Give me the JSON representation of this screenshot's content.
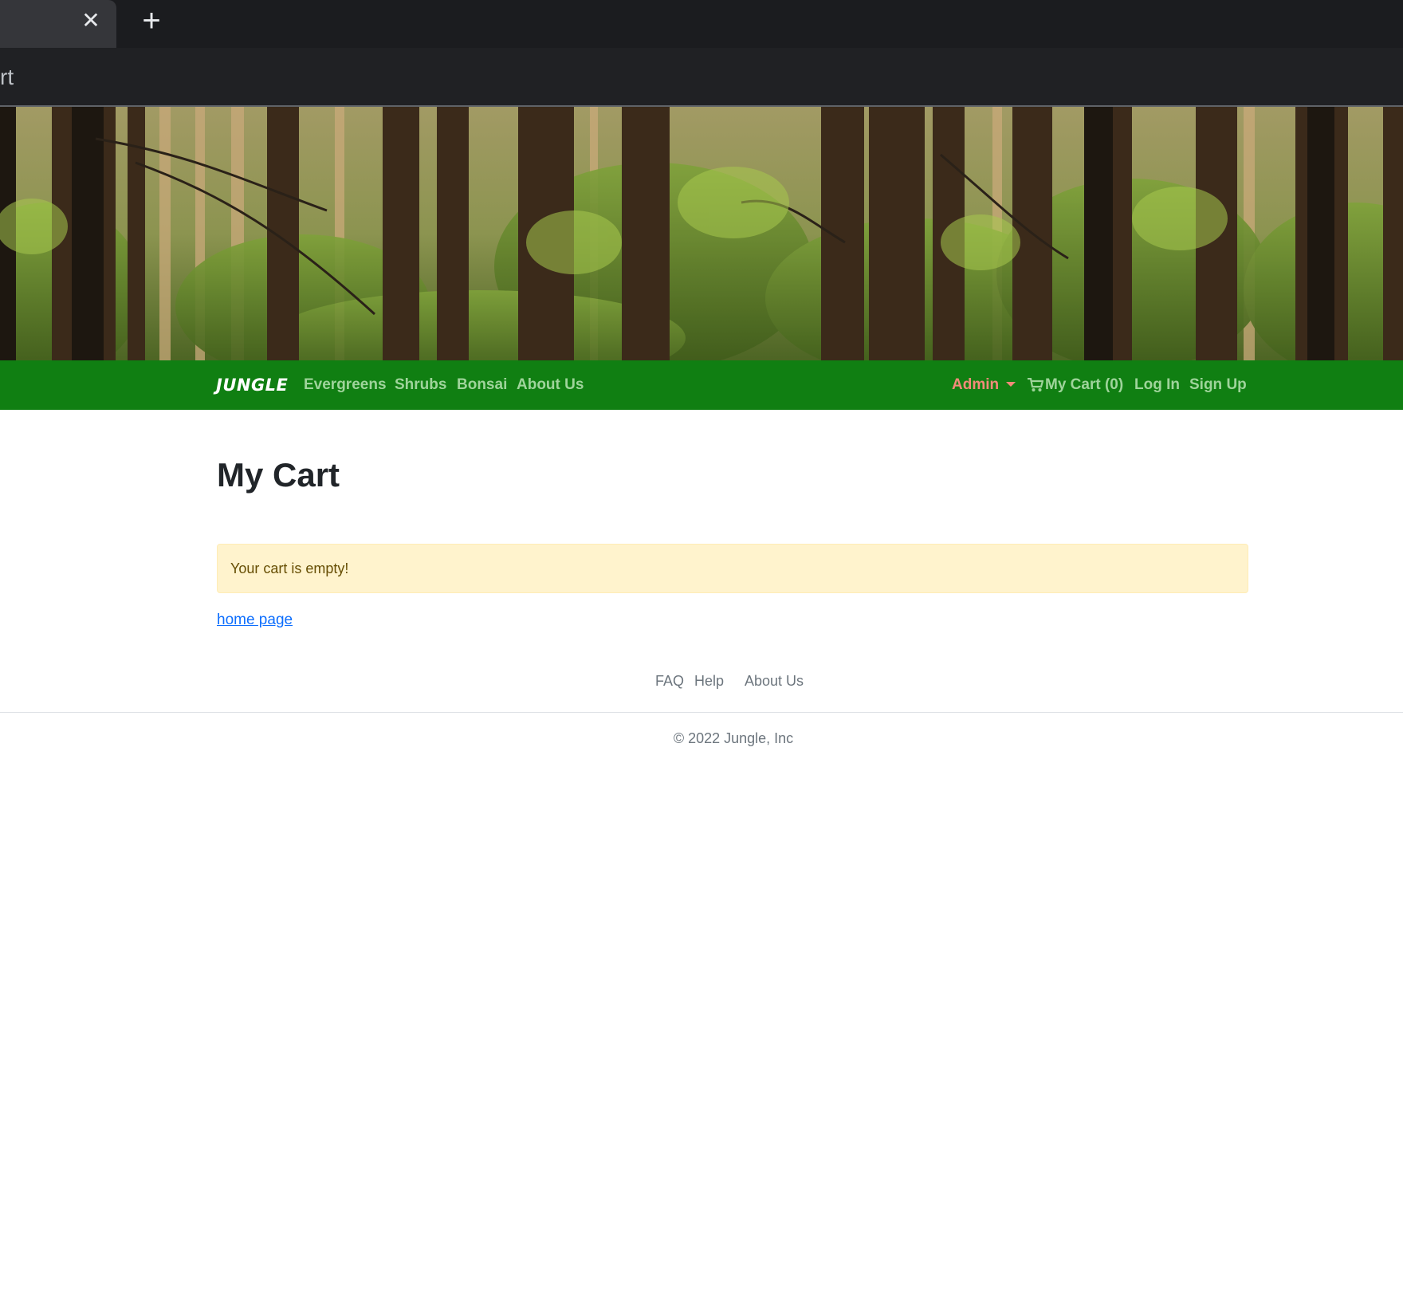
{
  "browser": {
    "close_tab_glyph": "✕",
    "new_tab_glyph": "+",
    "url_partial": "rt"
  },
  "hero": {
    "image": "forest-banner"
  },
  "navbar": {
    "brand": "JUNGLE",
    "links": [
      "Evergreens",
      "Shrubs",
      "Bonsai",
      "About Us"
    ],
    "admin_label": "Admin",
    "cart_label": "My Cart (0)",
    "login_label": "Log In",
    "signup_label": "Sign Up",
    "background_color": "#107f12",
    "link_color": "#9fd49b",
    "admin_color": "#f48b7a"
  },
  "main": {
    "title": "My Cart",
    "alert_text": "Your cart is empty!",
    "home_link": "home page"
  },
  "footer": {
    "links": [
      "FAQ",
      "Help",
      "About Us"
    ],
    "copyright": "© 2022 Jungle, Inc"
  }
}
